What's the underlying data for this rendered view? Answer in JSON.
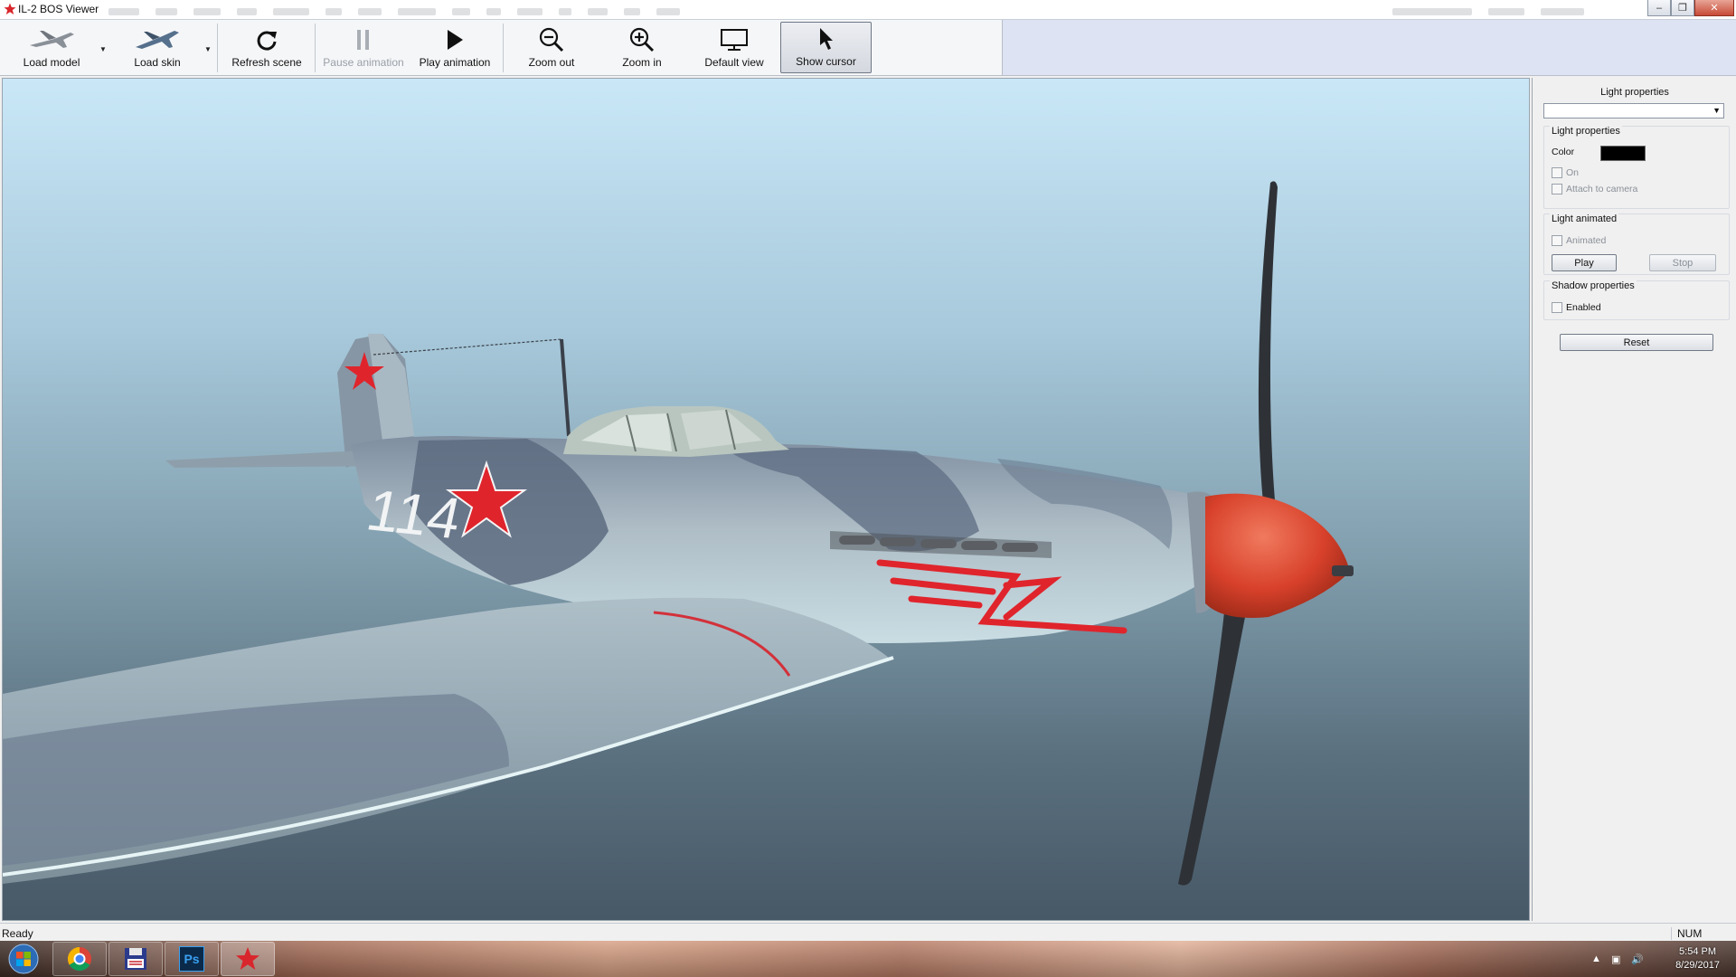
{
  "window": {
    "title": "IL-2 BOS Viewer"
  },
  "toolbar": {
    "load_model": "Load model",
    "load_skin": "Load skin",
    "refresh_scene": "Refresh scene",
    "pause_animation": "Pause animation",
    "play_animation": "Play animation",
    "zoom_out": "Zoom out",
    "zoom_in": "Zoom in",
    "default_view": "Default view",
    "show_cursor": "Show cursor"
  },
  "viewport": {
    "aircraft_number": "114",
    "colors": {
      "sky_top": "#c9e7f7",
      "sky_bottom": "#475866",
      "star_red": "#e0242c",
      "spinner": "#d8412b"
    }
  },
  "panel": {
    "title": "Light properties",
    "selected_light": "",
    "light_properties": {
      "title": "Light properties",
      "color_label": "Color",
      "color_value": "#000000",
      "on_label": "On",
      "attach_label": "Attach to camera"
    },
    "light_animated": {
      "title": "Light animated",
      "animated_label": "Animated",
      "play": "Play",
      "stop": "Stop"
    },
    "shadow_properties": {
      "title": "Shadow properties",
      "enabled_label": "Enabled"
    },
    "reset": "Reset"
  },
  "status": {
    "left": "Ready",
    "right": "NUM"
  },
  "taskbar": {
    "apps": [
      "start-orb",
      "chrome",
      "save-tool",
      "photoshop",
      "il2-viewer"
    ],
    "photoshop_label": "Ps",
    "time": "5:54 PM",
    "date": "8/29/2017"
  }
}
